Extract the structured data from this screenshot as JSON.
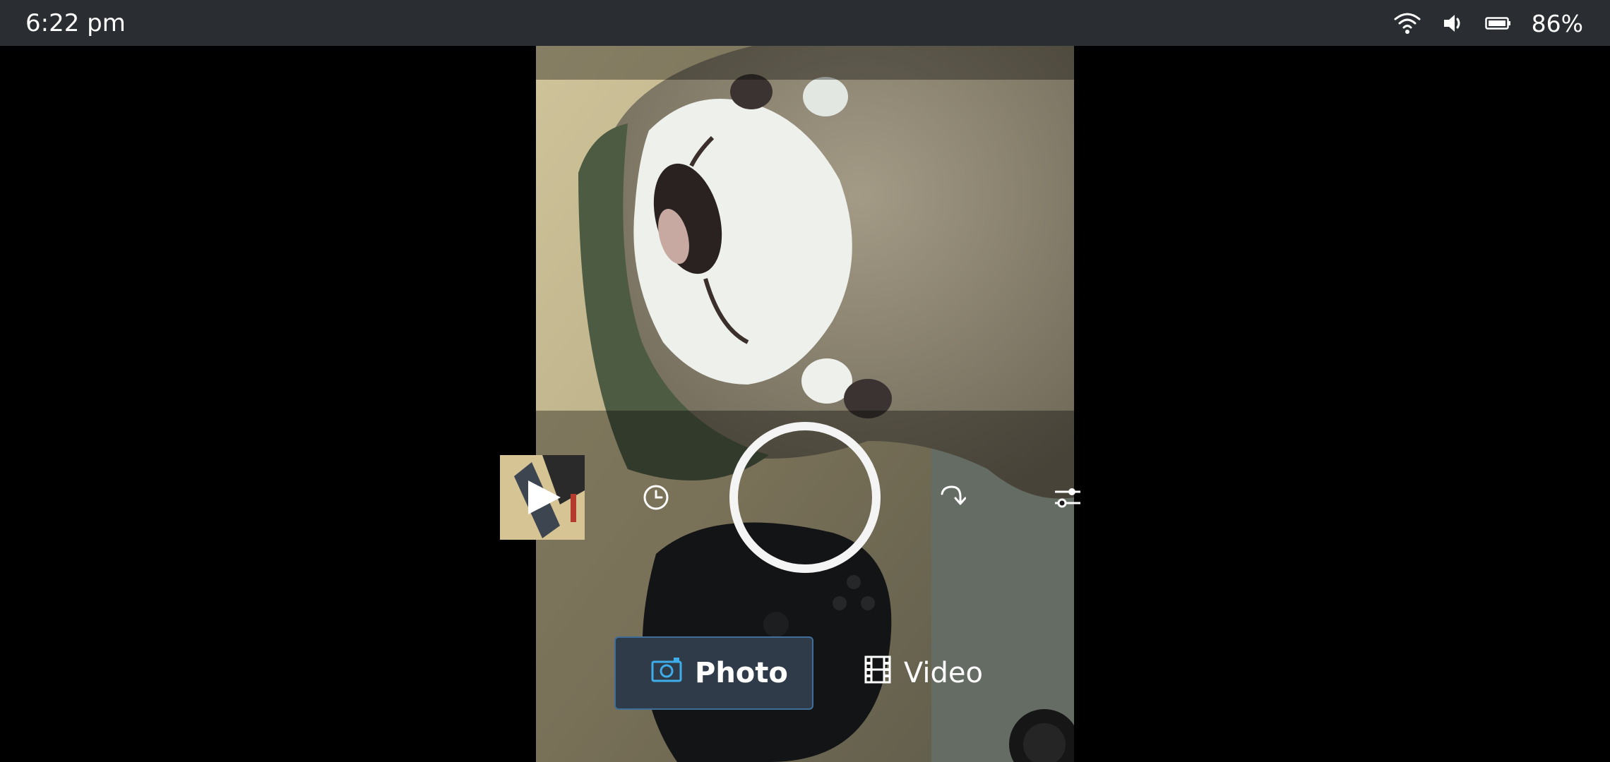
{
  "status_bar": {
    "time": "6:22 pm",
    "icons": [
      "wifi-icon",
      "volume-icon",
      "battery-icon"
    ],
    "battery_percent": "86%"
  },
  "camera": {
    "gallery_thumbnail": {
      "icon": "play-icon"
    },
    "controls": [
      "timer-icon",
      "shutter-button",
      "switch-camera-icon",
      "settings-sliders-icon"
    ],
    "modes": [
      {
        "label": "Photo",
        "icon": "camera-icon",
        "active": true
      },
      {
        "label": "Video",
        "icon": "film-icon",
        "active": false
      }
    ]
  },
  "colors": {
    "status_bar_bg": "#2a2e32",
    "active_mode_bg": "#2f3b48",
    "active_mode_border": "#3f6e98",
    "accent": "#3daee9"
  }
}
